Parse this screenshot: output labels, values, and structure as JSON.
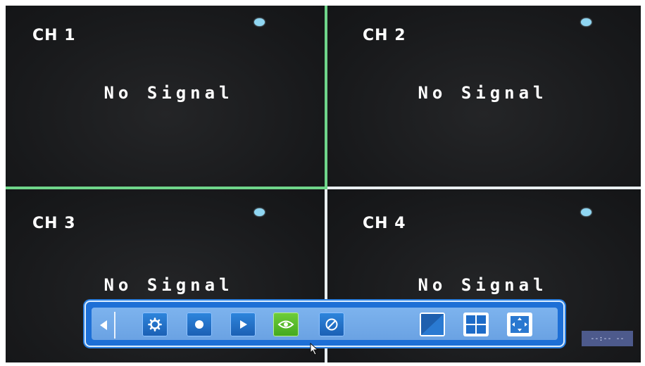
{
  "channels": [
    {
      "label": "CH 1",
      "status": "No Signal"
    },
    {
      "label": "CH 2",
      "status": "No Signal"
    },
    {
      "label": "CH 3",
      "status": "No Signal"
    },
    {
      "label": "CH 4",
      "status": "No Signal"
    }
  ],
  "toolbar": {
    "buttons": [
      {
        "name": "settings",
        "icon": "gear-icon"
      },
      {
        "name": "record",
        "icon": "record-icon"
      },
      {
        "name": "playback",
        "icon": "play-icon"
      },
      {
        "name": "live-view",
        "icon": "eye-icon",
        "active": true
      },
      {
        "name": "disable",
        "icon": "no-entry-icon"
      },
      {
        "name": "single-layout",
        "icon": "single-screen-icon"
      },
      {
        "name": "quad-layout",
        "icon": "quad-screen-icon"
      },
      {
        "name": "fullscreen",
        "icon": "fullscreen-icon"
      }
    ]
  },
  "clock": "--:-- --",
  "colors": {
    "active_divider": "#6fd58a",
    "toolbar_blue": "#1d6fd6",
    "active_button": "#56bb2b",
    "record_dot": "#8fd6f2"
  }
}
